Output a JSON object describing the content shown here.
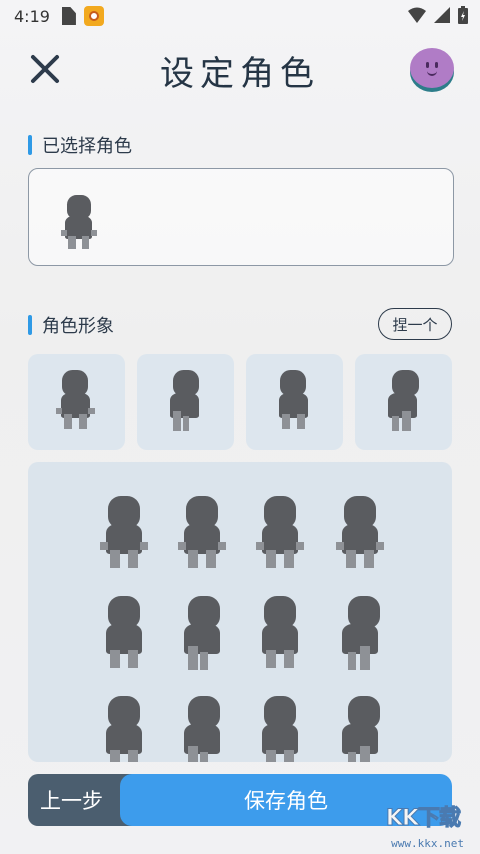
{
  "status_bar": {
    "time": "4:19"
  },
  "header": {
    "title": "设定角色"
  },
  "selected_section": {
    "label": "已选择角色"
  },
  "appearance_section": {
    "label": "角色形象",
    "pinch_label": "捏一个"
  },
  "footer": {
    "prev_label": "上一步",
    "save_label": "保存角色"
  },
  "watermark": {
    "logo_text": "KK下载",
    "url": "www.kkx.net"
  },
  "colors": {
    "accent": "#3d9cec",
    "dark_button": "#4b5e6f",
    "title": "#253545",
    "figure": "#5a5c60"
  },
  "thumbnails": [
    "front",
    "left",
    "back",
    "right"
  ],
  "grid_rows": [
    [
      "front",
      "front",
      "front",
      "front"
    ],
    [
      "back",
      "left",
      "back",
      "right"
    ],
    [
      "back",
      "left",
      "back",
      "right"
    ]
  ]
}
